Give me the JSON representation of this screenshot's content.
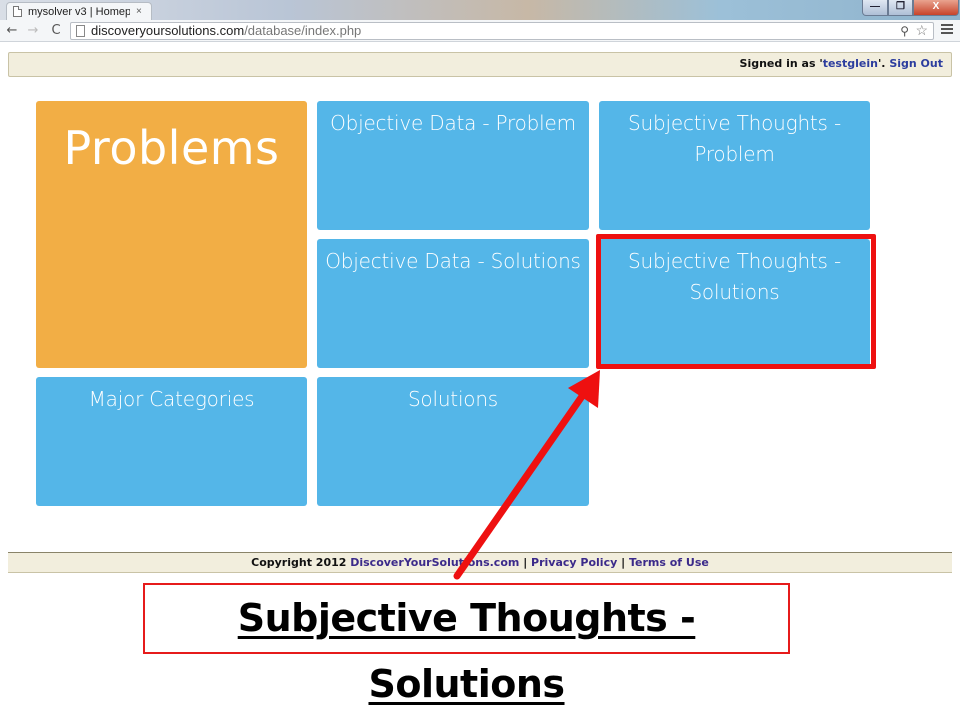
{
  "browser": {
    "tab_title": "mysolver v3 | Homep",
    "tab_close": "×",
    "url_host": "discoveryoursolutions.com",
    "url_path": "/database/index.php",
    "window_min": "—",
    "window_max": "❐",
    "window_close": "X",
    "back_glyph": "←",
    "forward_glyph": "→",
    "reload_glyph": "C",
    "zoom_glyph": "⚲",
    "star_glyph": "☆"
  },
  "header": {
    "signed_in_prefix": "Signed in as '",
    "username": "testglein",
    "signed_in_suffix": "'. ",
    "sign_out": "Sign Out"
  },
  "tiles": {
    "problems": "Problems",
    "objective_problem": "Objective Data - Problem",
    "subjective_problem": "Subjective Thoughts - Problem",
    "objective_solutions": "Objective Data - Solutions",
    "subjective_solutions": "Subjective Thoughts - Solutions",
    "major_categories": "Major Categories",
    "solutions": "Solutions"
  },
  "footer": {
    "copyright": "Copyright 2012 ",
    "site_link": "DiscoverYourSolutions.com",
    "sep1": " | ",
    "privacy": "Privacy Policy",
    "sep2": " | ",
    "terms": "Terms of Use"
  },
  "annotation": {
    "caption": "Subjective Thoughts - Solutions",
    "highlight_color": "#ee1010",
    "arrow_color": "#ee1010"
  },
  "colors": {
    "tile_blue": "#54b6e8",
    "tile_orange": "#f2ae45",
    "bar_beige": "#f2eedd"
  }
}
